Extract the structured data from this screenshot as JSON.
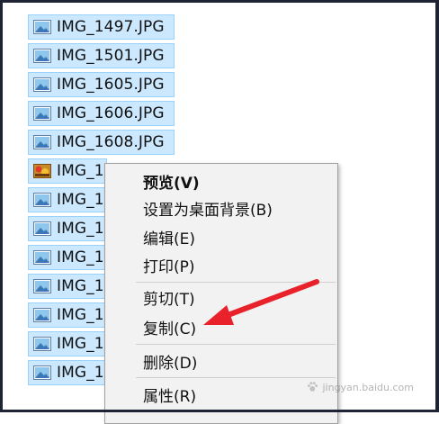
{
  "files": [
    {
      "name": "IMG_1497.JPG",
      "icon": "image-file-icon"
    },
    {
      "name": "IMG_1501.JPG",
      "icon": "image-file-icon"
    },
    {
      "name": "IMG_1605.JPG",
      "icon": "image-file-icon"
    },
    {
      "name": "IMG_1606.JPG",
      "icon": "image-file-icon"
    },
    {
      "name": "IMG_1608.JPG",
      "icon": "image-file-icon"
    },
    {
      "name": "IMG_1",
      "icon": "photo-thumbnail-icon"
    },
    {
      "name": "IMG_1",
      "icon": "image-file-icon"
    },
    {
      "name": "IMG_1",
      "icon": "image-file-icon"
    },
    {
      "name": "IMG_1",
      "icon": "image-file-icon"
    },
    {
      "name": "IMG_1",
      "icon": "image-file-icon"
    },
    {
      "name": "IMG_1",
      "icon": "image-file-icon"
    },
    {
      "name": "IMG_1",
      "icon": "image-file-icon"
    },
    {
      "name": "IMG_1",
      "icon": "image-file-icon"
    }
  ],
  "context_menu": {
    "items": [
      {
        "label": "预览(V)",
        "bold": true
      },
      {
        "label": "设置为桌面背景(B)",
        "bold": false
      },
      {
        "label": "编辑(E)",
        "bold": false
      },
      {
        "label": "打印(P)",
        "bold": false
      },
      {
        "label": "剪切(T)",
        "bold": false
      },
      {
        "label": "复制(C)",
        "bold": false
      },
      {
        "label": "删除(D)",
        "bold": false
      },
      {
        "label": "属性(R)",
        "bold": false
      }
    ]
  },
  "annotation": {
    "arrow_color": "#e8212a",
    "target": "复制(C)"
  },
  "watermark": {
    "text": "jingyan.baidu.com"
  },
  "colors": {
    "selection_fill": "#cce8ff",
    "selection_border": "#99d1ff",
    "menu_background": "#f2f2f2",
    "frame": "#1e2433"
  }
}
